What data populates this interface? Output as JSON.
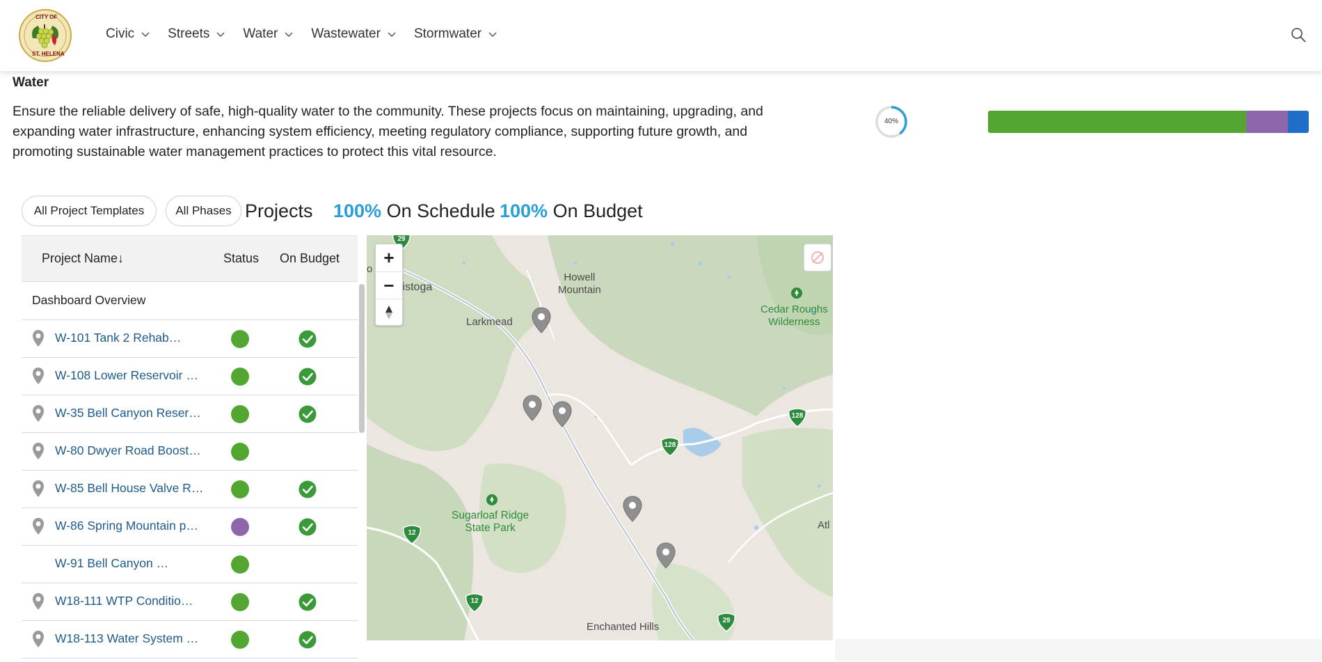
{
  "header": {
    "logo": {
      "top_text": "CITY OF",
      "bottom_text": "ST. HELENA"
    },
    "nav": [
      {
        "label": "Civic"
      },
      {
        "label": "Streets"
      },
      {
        "label": "Water"
      },
      {
        "label": "Wastewater"
      },
      {
        "label": "Stormwater"
      }
    ],
    "search_icon": "search-icon"
  },
  "section": {
    "title": "Water",
    "description": "Ensure the reliable delivery of safe, high-quality water to the community. These projects focus on maintaining, upgrading, and expanding water infrastructure, enhancing system efficiency, meeting regulatory compliance, supporting future growth, and promoting sustainable water management practices to protect this vital resource.",
    "progress": {
      "label": "40%",
      "value": 0.4,
      "color": "#2a9fd6"
    },
    "phase_bar": [
      {
        "fraction": 0.805,
        "color": "#54a632"
      },
      {
        "fraction": 0.131,
        "color": "#8e67ab"
      },
      {
        "fraction": 0.064,
        "color": "#1e6fc7"
      }
    ]
  },
  "filters": {
    "templates_label": "All Project Templates",
    "phases_label": "All Phases"
  },
  "kpis": {
    "projects_text": ". Projects",
    "schedule_pct": "100%",
    "schedule_label": "On Schedule",
    "budget_pct": "100%",
    "budget_label": "On Budget"
  },
  "table": {
    "col_name": "Project Name↓",
    "col_status": "Status",
    "col_budget": "On Budget",
    "overview_label": "Dashboard Overview",
    "rows": [
      {
        "name": "W-101 Tank 2 Rehab…",
        "pin": true,
        "status_color": "#54a632",
        "on_budget": true
      },
      {
        "name": "W-108 Lower Reservoir …",
        "pin": true,
        "status_color": "#54a632",
        "on_budget": true
      },
      {
        "name": "W-35 Bell Canyon Reser…",
        "pin": true,
        "status_color": "#54a632",
        "on_budget": true
      },
      {
        "name": "W-80 Dwyer Road Boost…",
        "pin": true,
        "status_color": "#54a632",
        "on_budget": false
      },
      {
        "name": "W-85 Bell House Valve R…",
        "pin": true,
        "status_color": "#54a632",
        "on_budget": true
      },
      {
        "name": "W-86 Spring Mountain p…",
        "pin": true,
        "status_color": "#8e67ab",
        "on_budget": true
      },
      {
        "name": "W-91 Bell Canyon …",
        "pin": false,
        "status_color": "#54a632",
        "on_budget": false
      },
      {
        "name": "W18-111 WTP Conditio…",
        "pin": true,
        "status_color": "#54a632",
        "on_budget": true
      },
      {
        "name": "W18-113 Water System …",
        "pin": true,
        "status_color": "#54a632",
        "on_budget": true
      }
    ]
  },
  "map": {
    "zoom_in": "+",
    "zoom_out": "−",
    "labels": {
      "calistoga": "listoga",
      "howell": "Howell\nMountain",
      "larkmead": "Larkmead",
      "cedar": "Cedar Roughs\nWilderness",
      "sugarloaf": "Sugarloaf Ridge\nState Park",
      "enchanted": "Enchanted Hills",
      "atl": "Atl",
      "edge": "o"
    },
    "highways": {
      "h29_top": "29",
      "h128_right": "128",
      "h128_mid": "128",
      "h12_left": "12",
      "h12_bottom": "12",
      "h29_bottom": "29"
    }
  }
}
